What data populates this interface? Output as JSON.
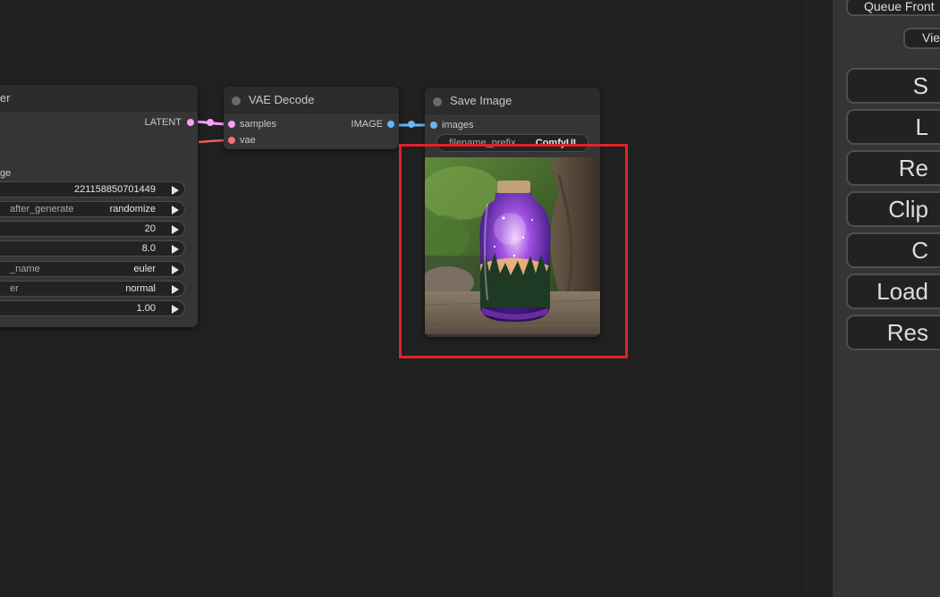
{
  "ksampler": {
    "title": "ler",
    "output_label": "LATENT",
    "section_label": "ge",
    "widgets": [
      {
        "label": "",
        "value": "221158850701449"
      },
      {
        "label": "after_generate",
        "value": "randomize"
      },
      {
        "label": "",
        "value": "20"
      },
      {
        "label": "",
        "value": "8.0"
      },
      {
        "label": "_name",
        "value": "euler"
      },
      {
        "label": "er",
        "value": "normal"
      },
      {
        "label": "",
        "value": "1.00"
      }
    ]
  },
  "vae_decode": {
    "title": "VAE Decode",
    "input_samples": "samples",
    "input_vae": "vae",
    "output_label": "IMAGE"
  },
  "save_image": {
    "title": "Save Image",
    "input_images": "images",
    "widget_label": "filename_prefix",
    "widget_value": "ComfyUI"
  },
  "sidebar": {
    "queue_front": "Queue Front",
    "view": "Vie",
    "buttons": [
      "S",
      "L",
      "Re",
      "Clip",
      "C",
      "Load",
      "Res"
    ]
  },
  "colors": {
    "latent_link": "#ff9cf9",
    "image_link": "#64b5f6",
    "vae_link": "#ff6e6e",
    "highlight": "#e0222a"
  }
}
